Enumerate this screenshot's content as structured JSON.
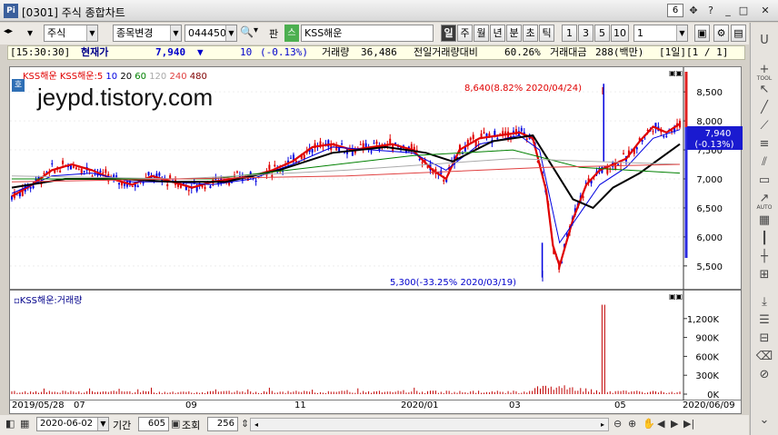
{
  "window": {
    "title": "[0301] 주식 종합차트",
    "number": "6"
  },
  "toolbar": {
    "market": "주식",
    "change_item": "종목변경",
    "code": "044450",
    "pan": "판",
    "name": "KSS해운",
    "periods": [
      "일",
      "주",
      "월",
      "년",
      "분",
      "초",
      "틱"
    ],
    "selected_period": "일",
    "minutes": [
      "1",
      "3",
      "5",
      "10"
    ],
    "interval_value": "1"
  },
  "info": {
    "time": "[15:30:30]",
    "label": "현재가",
    "price": "7,940",
    "change_arrow": "▼",
    "change": "10",
    "change_pct": "(-0.13%)",
    "volume_label": "거래량",
    "volume": "36,486",
    "prev_vol_label": "전일거래량대비",
    "prev_vol": "60.26%",
    "amount_label": "거래대금",
    "amount": "288(백만)",
    "page": "[1일][1 / 1]"
  },
  "price_chart": {
    "stock_badge": "호",
    "legend": [
      {
        "text": "KSS해운",
        "color": "#e00000"
      },
      {
        "text": "KSS해운:5",
        "color": "#e00000"
      },
      {
        "text": "10",
        "color": "#0000e0"
      },
      {
        "text": "20",
        "color": "#000000"
      },
      {
        "text": "60",
        "color": "#008000"
      },
      {
        "text": "120",
        "color": "#aaaaaa"
      },
      {
        "text": "240",
        "color": "#e04040"
      },
      {
        "text": "480",
        "color": "#800000"
      }
    ],
    "watermark": "jeypd.tistory.com",
    "high_annotation": "8,640(8.82% 2020/04/24)",
    "low_annotation": "5,300(-33.25% 2020/03/19)",
    "current_price": "7,940",
    "current_change": "(-0.13%)",
    "y_ticks": [
      "8,500",
      "8,000",
      "7,500",
      "7,000",
      "6,500",
      "6,000",
      "5,500"
    ]
  },
  "volume_chart": {
    "legend": "KSS해운:거래량",
    "y_ticks": [
      "1,200K",
      "900K",
      "600K",
      "300K",
      "0K"
    ]
  },
  "x_axis": [
    "2019/05/28",
    "07",
    "09",
    "11",
    "2020/01",
    "03",
    "05",
    "2020/06/09"
  ],
  "bottom": {
    "date": "2020-06-02",
    "period_label": "기간",
    "period_value": "605",
    "lookup_label": "조회",
    "lookup_value": "256"
  },
  "chart_data": {
    "type": "line",
    "title": "",
    "y_unit": "KRW",
    "ylim": [
      5200,
      8800
    ],
    "x_range": [
      "2019/05/28",
      "2020/06/09"
    ],
    "series": [
      {
        "name": "KSS해운:5",
        "points": [
          [
            0,
            6700
          ],
          [
            0.03,
            6900
          ],
          [
            0.06,
            7150
          ],
          [
            0.09,
            7250
          ],
          [
            0.12,
            7150
          ],
          [
            0.15,
            7000
          ],
          [
            0.18,
            6900
          ],
          [
            0.21,
            7050
          ],
          [
            0.24,
            6950
          ],
          [
            0.27,
            6850
          ],
          [
            0.3,
            6950
          ],
          [
            0.33,
            7000
          ],
          [
            0.36,
            7050
          ],
          [
            0.39,
            7150
          ],
          [
            0.42,
            7300
          ],
          [
            0.45,
            7550
          ],
          [
            0.48,
            7600
          ],
          [
            0.51,
            7500
          ],
          [
            0.54,
            7550
          ],
          [
            0.57,
            7600
          ],
          [
            0.6,
            7500
          ],
          [
            0.63,
            7150
          ],
          [
            0.65,
            7000
          ],
          [
            0.67,
            7500
          ],
          [
            0.7,
            7700
          ],
          [
            0.73,
            7750
          ],
          [
            0.76,
            7800
          ],
          [
            0.78,
            7700
          ],
          [
            0.8,
            6800
          ],
          [
            0.81,
            5850
          ],
          [
            0.82,
            5500
          ],
          [
            0.84,
            6300
          ],
          [
            0.86,
            6900
          ],
          [
            0.88,
            7150
          ],
          [
            0.9,
            7250
          ],
          [
            0.92,
            7350
          ],
          [
            0.94,
            7650
          ],
          [
            0.96,
            7900
          ],
          [
            0.98,
            7800
          ],
          [
            1.0,
            7950
          ]
        ]
      },
      {
        "name": "10",
        "points": [
          [
            0,
            6750
          ],
          [
            0.06,
            7050
          ],
          [
            0.12,
            7100
          ],
          [
            0.18,
            6950
          ],
          [
            0.24,
            6950
          ],
          [
            0.3,
            6900
          ],
          [
            0.36,
            7000
          ],
          [
            0.42,
            7250
          ],
          [
            0.48,
            7550
          ],
          [
            0.54,
            7500
          ],
          [
            0.6,
            7450
          ],
          [
            0.65,
            7150
          ],
          [
            0.7,
            7600
          ],
          [
            0.76,
            7750
          ],
          [
            0.79,
            7500
          ],
          [
            0.82,
            5900
          ],
          [
            0.85,
            6400
          ],
          [
            0.88,
            6900
          ],
          [
            0.92,
            7200
          ],
          [
            0.96,
            7700
          ],
          [
            1.0,
            7850
          ]
        ]
      },
      {
        "name": "20",
        "points": [
          [
            0,
            6850
          ],
          [
            0.08,
            7000
          ],
          [
            0.16,
            7000
          ],
          [
            0.24,
            6950
          ],
          [
            0.32,
            6950
          ],
          [
            0.4,
            7150
          ],
          [
            0.48,
            7450
          ],
          [
            0.56,
            7550
          ],
          [
            0.62,
            7450
          ],
          [
            0.66,
            7300
          ],
          [
            0.72,
            7650
          ],
          [
            0.78,
            7750
          ],
          [
            0.81,
            7200
          ],
          [
            0.84,
            6650
          ],
          [
            0.87,
            6500
          ],
          [
            0.9,
            6850
          ],
          [
            0.94,
            7100
          ],
          [
            1.0,
            7600
          ]
        ]
      },
      {
        "name": "60",
        "points": [
          [
            0,
            7000
          ],
          [
            0.15,
            7000
          ],
          [
            0.3,
            7000
          ],
          [
            0.45,
            7200
          ],
          [
            0.6,
            7400
          ],
          [
            0.75,
            7500
          ],
          [
            0.85,
            7200
          ],
          [
            1.0,
            7100
          ]
        ]
      },
      {
        "name": "120",
        "points": [
          [
            0,
            7050
          ],
          [
            0.25,
            7000
          ],
          [
            0.5,
            7150
          ],
          [
            0.75,
            7350
          ],
          [
            1.0,
            7250
          ]
        ]
      },
      {
        "name": "240",
        "points": [
          [
            0,
            6950
          ],
          [
            0.5,
            7050
          ],
          [
            0.8,
            7200
          ],
          [
            1.0,
            7250
          ]
        ]
      }
    ],
    "annotations": [
      {
        "label": "high",
        "date": "2020/04/24",
        "value": 8640
      },
      {
        "label": "low",
        "date": "2020/03/19",
        "value": 5300
      }
    ]
  }
}
